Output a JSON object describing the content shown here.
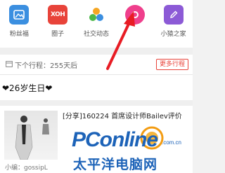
{
  "shortcuts": [
    {
      "label": "粉丝福",
      "icon": "image-icon",
      "color": "#3b8fe0"
    },
    {
      "label": "圈子",
      "icon": "group-badge-icon",
      "badge": "XOH",
      "color": "#e8433a"
    },
    {
      "label": "社交动态",
      "icon": "social-dots-icon"
    },
    {
      "label": "",
      "icon": "pink-circle-icon",
      "color": "#ef3f8c"
    },
    {
      "label": "小猿之家",
      "icon": "edit-icon",
      "color": "#8c5ad6"
    }
  ],
  "trip": {
    "text": "下个行程：255天后",
    "more_label": "更多行程"
  },
  "birthday": {
    "text": "❤26岁生日❤"
  },
  "post": {
    "title": "[分享]160224 首席设计师Bailev评价",
    "author": "小编：gossipL"
  },
  "watermark": {
    "site": "PConline",
    "domain": ".com.cn",
    "cn": "太平洋电脑网"
  },
  "colors": {
    "accent_red": "#e8433a",
    "arrow_red": "#e81c24",
    "watermark_blue": "#1d63b8"
  }
}
